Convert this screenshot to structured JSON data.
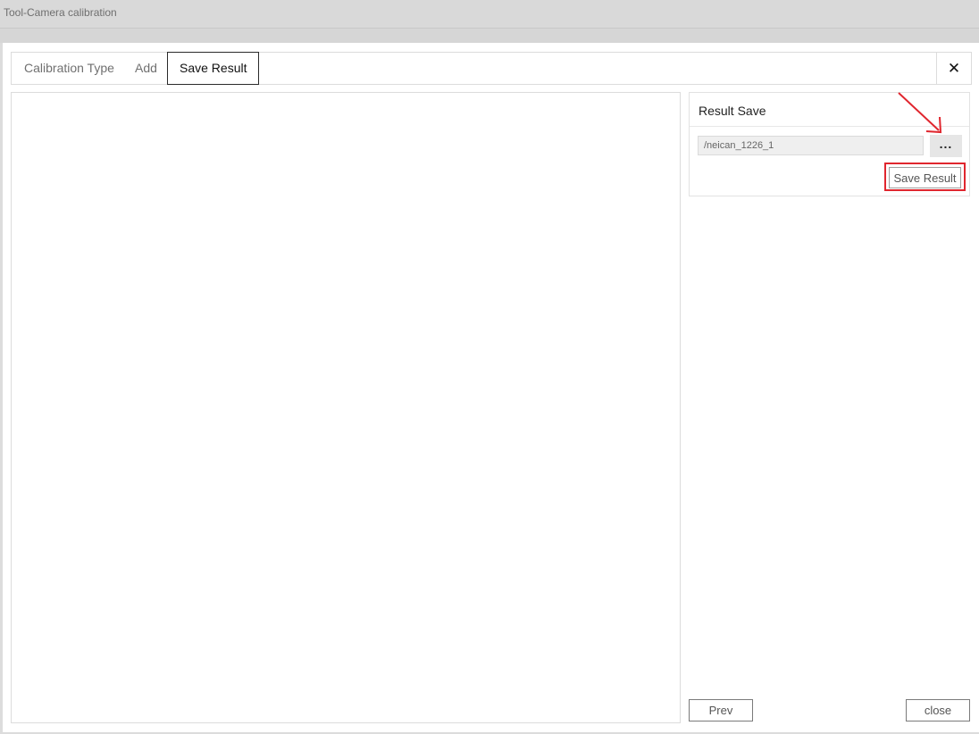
{
  "window": {
    "title": "Tool-Camera calibration"
  },
  "tabs": [
    {
      "label": "Calibration Type",
      "active": false
    },
    {
      "label": "Add",
      "active": false
    },
    {
      "label": "Save Result",
      "active": true
    }
  ],
  "result_panel": {
    "header": "Result Save",
    "path_value": "/neican_1226_1",
    "browse_label": "...",
    "save_label": "Save Result"
  },
  "footer": {
    "prev_label": "Prev",
    "close_label": "close"
  },
  "icons": {
    "tab_close": "close-icon",
    "browse": "ellipsis-icon",
    "annotation": "red-arrow-icon"
  },
  "colors": {
    "annotation_red": "#e0262e"
  }
}
